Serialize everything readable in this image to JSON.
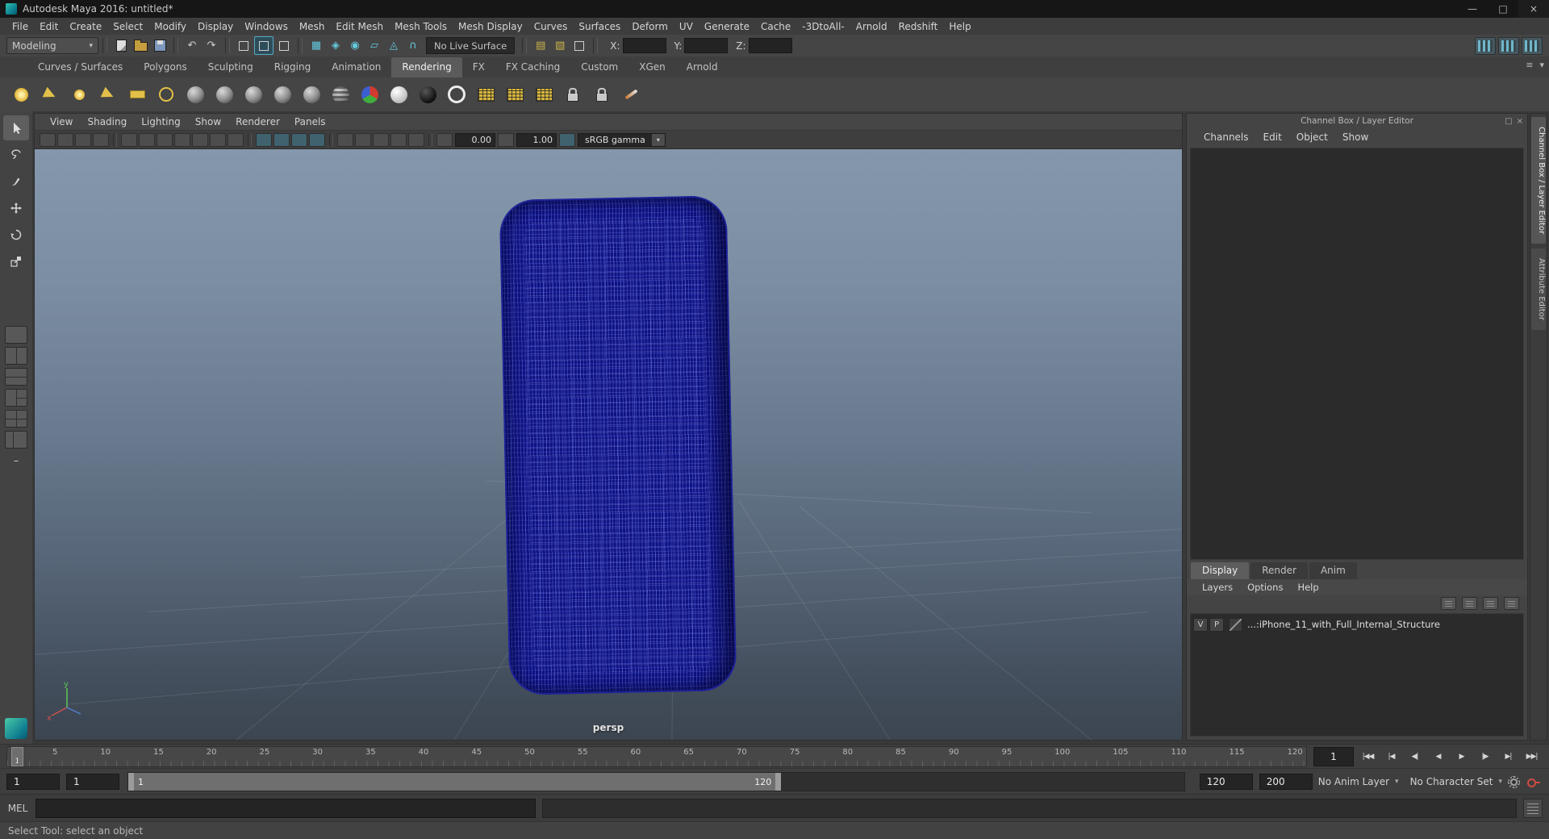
{
  "window": {
    "title": "Autodesk Maya 2016: untitled*"
  },
  "menubar": {
    "items": [
      "File",
      "Edit",
      "Create",
      "Select",
      "Modify",
      "Display",
      "Windows",
      "Mesh",
      "Edit Mesh",
      "Mesh Tools",
      "Mesh Display",
      "Curves",
      "Surfaces",
      "Deform",
      "UV",
      "Generate",
      "Cache",
      "-3DtoAll-",
      "Arnold",
      "Redshift",
      "Help"
    ]
  },
  "statusline": {
    "mode": "Modeling",
    "live_surface": "No Live Surface",
    "x_label": "X:",
    "y_label": "Y:",
    "z_label": "Z:"
  },
  "shelf": {
    "tabs": [
      "Curves / Surfaces",
      "Polygons",
      "Sculpting",
      "Rigging",
      "Animation",
      "Rendering",
      "FX",
      "FX Caching",
      "Custom",
      "XGen",
      "Arnold"
    ],
    "active_tab": "Rendering"
  },
  "viewport": {
    "menus": [
      "View",
      "Shading",
      "Lighting",
      "Show",
      "Renderer",
      "Panels"
    ],
    "exposure": "0.00",
    "gamma": "1.00",
    "view_transform": "sRGB gamma",
    "camera": "persp",
    "axis_x": "x",
    "axis_y": "y"
  },
  "channel_box": {
    "title": "Channel Box / Layer Editor",
    "menus": [
      "Channels",
      "Edit",
      "Object",
      "Show"
    ]
  },
  "layer_editor": {
    "tabs": [
      "Display",
      "Render",
      "Anim"
    ],
    "active_tab": "Display",
    "menus": [
      "Layers",
      "Options",
      "Help"
    ],
    "layer": {
      "visibility": "V",
      "playback": "P",
      "name": "...:iPhone_11_with_Full_Internal_Structure"
    }
  },
  "side_tabs": {
    "channel_box": "Channel Box / Layer Editor",
    "attribute_editor": "Attribute Editor"
  },
  "timeline": {
    "ticks": [
      "5",
      "10",
      "15",
      "20",
      "25",
      "30",
      "35",
      "40",
      "45",
      "50",
      "55",
      "60",
      "65",
      "70",
      "75",
      "80",
      "85",
      "90",
      "95",
      "100",
      "105",
      "110",
      "115",
      "120"
    ],
    "marker": "1",
    "current_frame": "1",
    "transport": [
      "|◀◀",
      "|◀",
      "◀|",
      "◀",
      "▶",
      "|▶",
      "▶|",
      "▶▶|"
    ]
  },
  "range_slider": {
    "anim_start": "1",
    "play_start": "1",
    "bar_start": "1",
    "bar_end": "120",
    "play_end": "120",
    "anim_end": "200",
    "anim_layer": "No Anim Layer",
    "character_set": "No Character Set"
  },
  "command_line": {
    "label": "MEL"
  },
  "help_line": {
    "message": "Select Tool: select an object"
  },
  "ui": {
    "arrow_down": "▾",
    "arrow_up": "▴",
    "menu": "≡",
    "minimize": "—",
    "maximize": "□",
    "close": "×",
    "undo": "↶",
    "redo": "↷",
    "snap_grid": "▦",
    "snap_curve": "◈",
    "snap_point": "◉",
    "snap_plane": "▱",
    "snap_view": "◬",
    "make_live": "∩",
    "history_in": "▤",
    "history_out": "▧"
  },
  "colors": {
    "viewport_top": "#8497ab",
    "viewport_bottom": "#3c4550",
    "wireframe_base": "#10127f",
    "accent_teal": "#63c9dc"
  }
}
